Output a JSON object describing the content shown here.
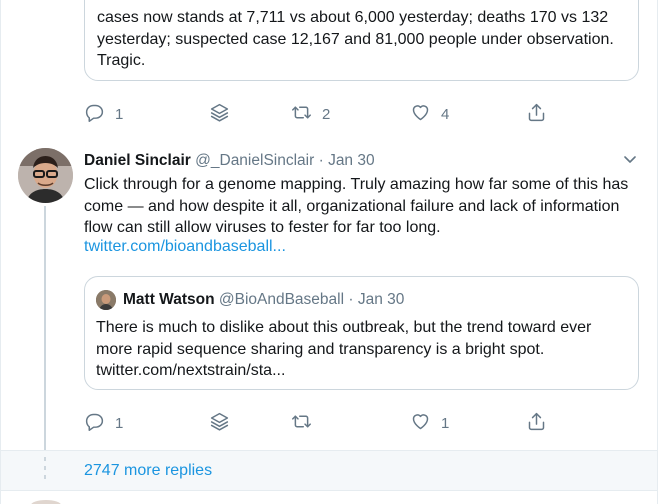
{
  "top_quote": {
    "text": "cases now stands at 7,711 vs about 6,000 yesterday; deaths 170 vs 132 yesterday; suspected case 12,167 and 81,000 people under observation. Tragic."
  },
  "actions_1": {
    "reply_count": "1",
    "retweet_count": "2",
    "like_count": "4"
  },
  "tweet": {
    "name": "Daniel Sinclair",
    "handle": "@_DanielSinclair",
    "sep": "·",
    "date": "Jan 30",
    "body": "Click through for a genome mapping. Truly amazing how far some of this has come — and how despite it all, organizational failure and lack of information flow can still allow viruses to fester for far too long.",
    "link": "twitter.com/bioandbaseball..."
  },
  "quoted": {
    "name": "Matt Watson",
    "handle": "@BioAndBaseball",
    "sep": "·",
    "date": "Jan 30",
    "body": "There is much to dislike about this outbreak, but the trend toward ever more rapid sequence sharing and transparency is a bright spot. twitter.com/nextstrain/sta..."
  },
  "actions_2": {
    "reply_count": "1",
    "retweet_count": "",
    "like_count": "1"
  },
  "more_replies": "2747 more replies",
  "icons": {
    "reply": "reply-icon",
    "stack": "stack-icon",
    "retweet": "retweet-icon",
    "like": "heart-icon",
    "share": "share-icon",
    "chevron": "chevron-down-icon"
  },
  "colors": {
    "link": "#1b95e0",
    "muted": "#657786",
    "border": "#ccd6dd"
  }
}
